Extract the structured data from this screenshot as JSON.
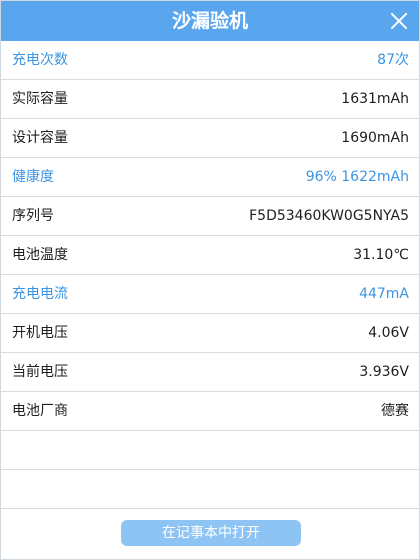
{
  "window": {
    "title": "沙漏验机"
  },
  "rows": [
    {
      "label": "充电次数",
      "value": "87次",
      "highlight": true
    },
    {
      "label": "实际容量",
      "value": "1631mAh",
      "highlight": false
    },
    {
      "label": "设计容量",
      "value": "1690mAh",
      "highlight": false
    },
    {
      "label": "健康度",
      "value": "96% 1622mAh",
      "highlight": true
    },
    {
      "label": "序列号",
      "value": "F5D53460KW0G5NYA5",
      "highlight": false
    },
    {
      "label": "电池温度",
      "value": "31.10℃",
      "highlight": false
    },
    {
      "label": "充电电流",
      "value": "447mA",
      "highlight": true
    },
    {
      "label": "开机电压",
      "value": "4.06V",
      "highlight": false
    },
    {
      "label": "当前电压",
      "value": "3.936V",
      "highlight": false
    },
    {
      "label": "电池厂商",
      "value": "德赛",
      "highlight": false
    }
  ],
  "footer": {
    "open_notepad_label": "在记事本中打开"
  },
  "colors": {
    "titlebar": "#5aa6ee",
    "highlight_text": "#3c95e2",
    "button": "#8ec4f3"
  },
  "icons": {
    "close": "close-icon"
  }
}
